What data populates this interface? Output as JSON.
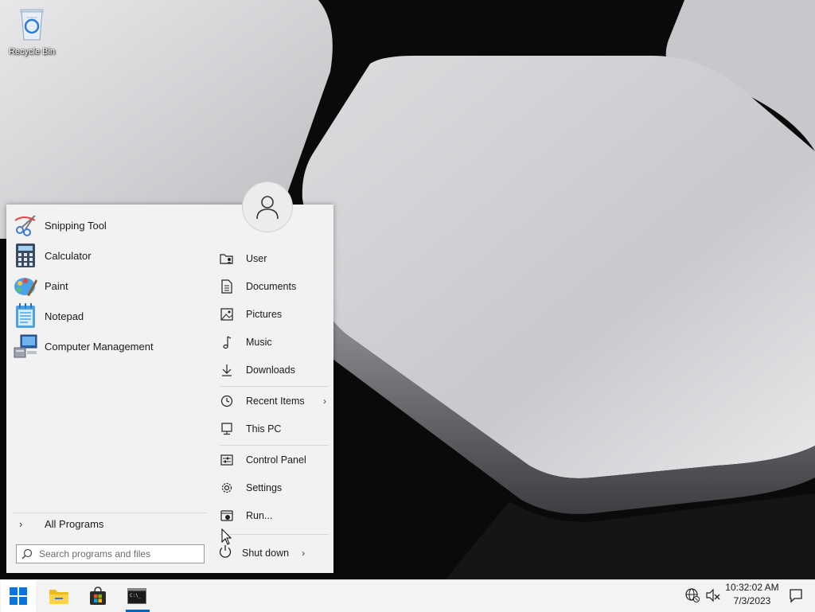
{
  "desktop": {
    "icons": [
      {
        "label": "Recycle Bin",
        "icon": "recycle-bin-icon"
      }
    ]
  },
  "start_menu": {
    "programs": [
      {
        "label": "Snipping Tool",
        "icon": "snipping-tool-icon"
      },
      {
        "label": "Calculator",
        "icon": "calculator-icon"
      },
      {
        "label": "Paint",
        "icon": "paint-icon"
      },
      {
        "label": "Notepad",
        "icon": "notepad-icon"
      },
      {
        "label": "Computer Management",
        "icon": "computer-management-icon"
      }
    ],
    "all_programs_label": "All Programs",
    "search_placeholder": "Search programs and files",
    "avatar_icon": "user-avatar-icon",
    "links": [
      {
        "label": "User",
        "icon": "user-folder-icon"
      },
      {
        "label": "Documents",
        "icon": "document-icon"
      },
      {
        "label": "Pictures",
        "icon": "picture-icon"
      },
      {
        "label": "Music",
        "icon": "music-note-icon"
      },
      {
        "label": "Downloads",
        "icon": "download-arrow-icon"
      },
      {
        "label": "Recent Items",
        "icon": "clock-icon",
        "has_submenu": true
      },
      {
        "label": "This PC",
        "icon": "computer-icon"
      },
      {
        "label": "Control Panel",
        "icon": "control-panel-icon"
      },
      {
        "label": "Settings",
        "icon": "gear-icon"
      },
      {
        "label": "Run...",
        "icon": "run-icon"
      }
    ],
    "shutdown_label": "Shut down"
  },
  "taskbar": {
    "buttons": [
      {
        "name": "start",
        "icon": "windows-logo-icon",
        "active": true
      },
      {
        "name": "file-explorer",
        "icon": "folder-icon"
      },
      {
        "name": "microsoft-store",
        "icon": "store-bag-icon"
      },
      {
        "name": "command-prompt",
        "icon": "terminal-icon",
        "running": true
      }
    ],
    "tray": {
      "network_icon": "network-globe-icon",
      "volume_icon": "speaker-muted-icon",
      "time": "10:32:02 AM",
      "date": "7/3/2023",
      "notification_icon": "notification-icon"
    }
  },
  "colors": {
    "accent": "#0067c0",
    "menu_bg": "#f2f2f2",
    "taskbar_bg": "#f3f3f3"
  }
}
